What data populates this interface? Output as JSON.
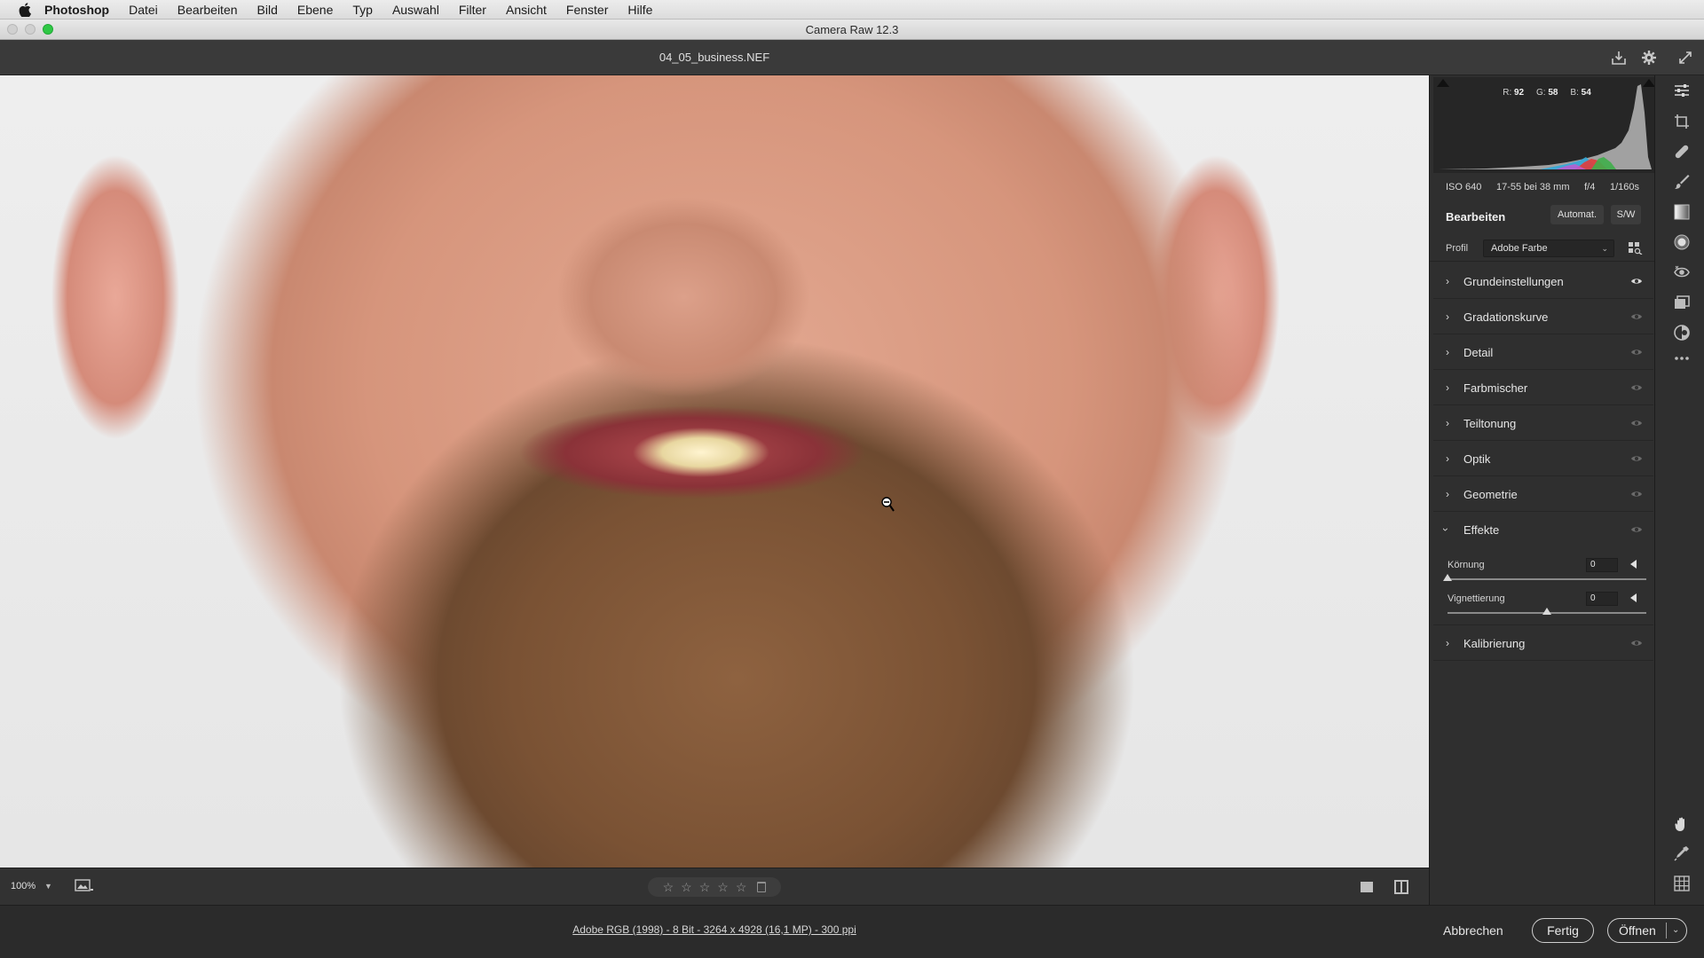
{
  "menubar": {
    "apple_icon": "apple-icon",
    "items": [
      "Photoshop",
      "Datei",
      "Bearbeiten",
      "Bild",
      "Ebene",
      "Typ",
      "Auswahl",
      "Filter",
      "Ansicht",
      "Fenster",
      "Hilfe"
    ]
  },
  "window": {
    "title": "Camera Raw 12.3"
  },
  "header": {
    "filename": "04_05_business.NEF",
    "icons": [
      "save-icon",
      "settings-icon",
      "fullscreen-icon"
    ]
  },
  "histogram": {
    "r_label": "R:",
    "r_value": "92",
    "g_label": "G:",
    "g_value": "58",
    "b_label": "B:",
    "b_value": "54"
  },
  "exif": {
    "iso": "ISO 640",
    "lens": "17-55 bei 38 mm",
    "aperture": "f/4",
    "shutter": "1/160s"
  },
  "edit": {
    "title": "Bearbeiten",
    "auto_label": "Automat.",
    "bw_label": "S/W",
    "profile_label": "Profil",
    "profile_value": "Adobe Farbe"
  },
  "sections": [
    {
      "title": "Grundeinstellungen",
      "expanded": false
    },
    {
      "title": "Gradationskurve",
      "expanded": false
    },
    {
      "title": "Detail",
      "expanded": false
    },
    {
      "title": "Farbmischer",
      "expanded": false
    },
    {
      "title": "Teiltonung",
      "expanded": false
    },
    {
      "title": "Optik",
      "expanded": false
    },
    {
      "title": "Geometrie",
      "expanded": false
    },
    {
      "title": "Effekte",
      "expanded": true
    },
    {
      "title": "Kalibrierung",
      "expanded": false
    }
  ],
  "effects": {
    "grain_label": "Körnung",
    "grain_value": "0",
    "grain_position": 0.0,
    "vignette_label": "Vignettierung",
    "vignette_value": "0",
    "vignette_position": 0.5
  },
  "bottom": {
    "zoom": "100%",
    "rating_stars": 5
  },
  "footer": {
    "info": "Adobe RGB (1998) - 8 Bit - 3264 x 4928 (16,1 MP) - 300 ppi",
    "cancel": "Abbrechen",
    "done": "Fertig",
    "open": "Öffnen"
  },
  "tools": [
    "edit-icon",
    "crop-icon",
    "healing-icon",
    "brush-icon",
    "gradient-icon",
    "radial-icon",
    "redeye-icon",
    "snapshots-icon",
    "presets-icon",
    "more-icon",
    "hand-icon",
    "eyedropper-icon",
    "grid-icon"
  ]
}
